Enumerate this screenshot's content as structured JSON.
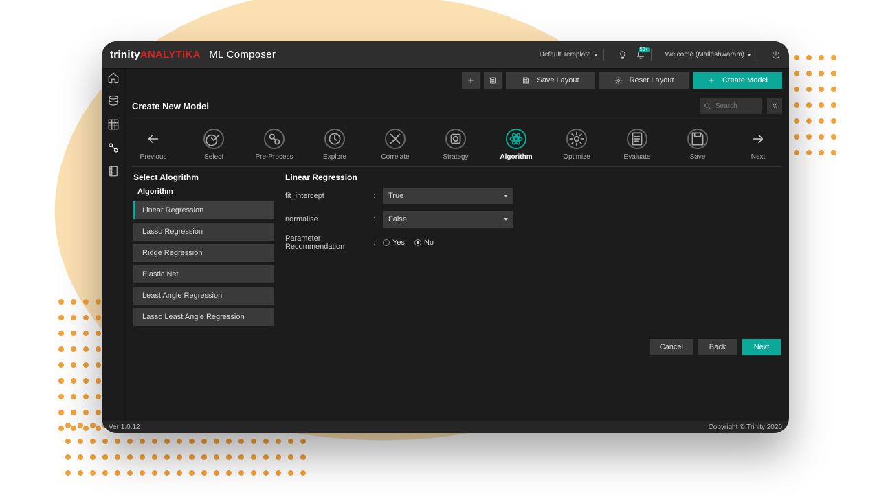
{
  "brand": {
    "part1": "trinity",
    "part2": "ANALYTIKA",
    "app": "ML Composer"
  },
  "topbar": {
    "template_label": "Default Template",
    "welcome": "Welcome (Malleshwaram)",
    "notify_badge": "99+"
  },
  "toolbar": {
    "save_layout": "Save Layout",
    "reset_layout": "Reset Layout",
    "create_model": "Create Model"
  },
  "section": {
    "title": "Create New Model",
    "search_placeholder": "Search"
  },
  "stepper": {
    "prev": "Previous",
    "next": "Next",
    "steps": [
      {
        "label": "Select"
      },
      {
        "label": "Pre-Process"
      },
      {
        "label": "Explore"
      },
      {
        "label": "Correlate"
      },
      {
        "label": "Strategy"
      },
      {
        "label": "Algorithm"
      },
      {
        "label": "Optimize"
      },
      {
        "label": "Evaluate"
      },
      {
        "label": "Save"
      }
    ],
    "active_index": 5
  },
  "left": {
    "title": "Select Alogrithm",
    "subtitle": "Algorithm",
    "items": [
      "Linear Regression",
      "Lasso Regression",
      "Ridge Regression",
      "Elastic Net",
      "Least Angle Regression",
      "Lasso Least Angle Regression"
    ],
    "selected_index": 0
  },
  "right": {
    "title": "Linear Regression",
    "params": {
      "fit_intercept": {
        "label": "fit_intercept",
        "value": "True"
      },
      "normalise": {
        "label": "normalise",
        "value": "False"
      },
      "recommendation": {
        "label": "Parameter Recommendation",
        "options": [
          "Yes",
          "No"
        ],
        "selected": "No"
      }
    }
  },
  "footer": {
    "cancel": "Cancel",
    "back": "Back",
    "next": "Next"
  },
  "status": {
    "version": "Ver 1.0.12",
    "copyright": "Copyright © Trinity 2020"
  }
}
